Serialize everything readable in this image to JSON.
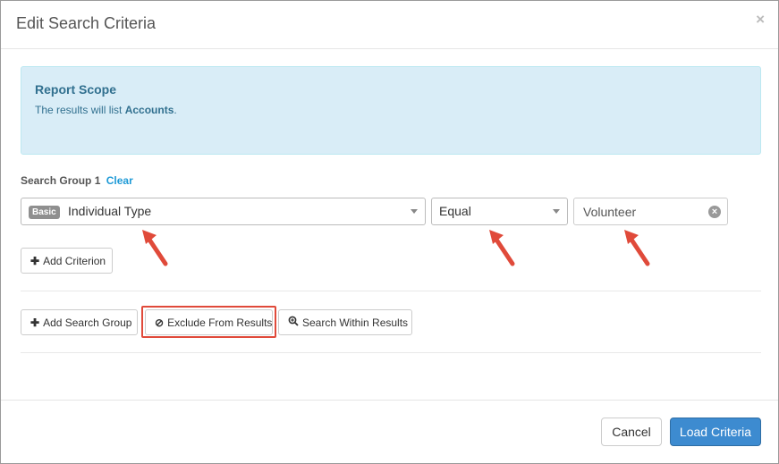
{
  "modal": {
    "title": "Edit Search Criteria",
    "close": "×"
  },
  "scope": {
    "title": "Report Scope",
    "text_before": "The results will list ",
    "entity": "Accounts",
    "text_after": "."
  },
  "search_group": {
    "label": "Search Group 1",
    "clear": "Clear",
    "criterion": {
      "badge": "Basic",
      "field": "Individual Type",
      "operator": "Equal",
      "value": "Volunteer"
    },
    "add_criterion": "Add Criterion"
  },
  "actions": {
    "add_search_group": "Add Search Group",
    "exclude_from_results": "Exclude From Results",
    "search_within_results": "Search Within Results"
  },
  "footer": {
    "cancel": "Cancel",
    "load": "Load Criteria"
  },
  "colors": {
    "annotation": "#e04a3a",
    "primary": "#3d8bd0",
    "info_bg": "#d9edf7"
  }
}
